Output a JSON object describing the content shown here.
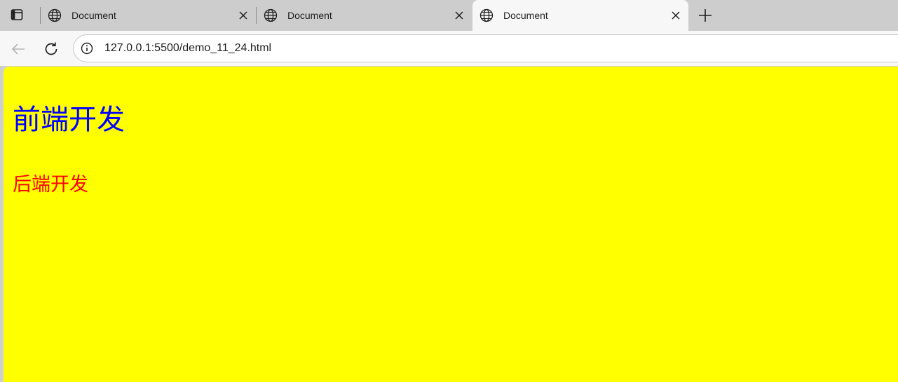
{
  "browser": {
    "tabs": [
      {
        "title": "Document",
        "active": false
      },
      {
        "title": "Document",
        "active": false
      },
      {
        "title": "Document",
        "active": true
      }
    ],
    "url": "127.0.0.1:5500/demo_11_24.html"
  },
  "page": {
    "background_color": "#ffff00",
    "heading_front": {
      "text": "前端开发",
      "color": "#0000ff"
    },
    "heading_back": {
      "text": "后端开发",
      "color": "#ff0000"
    }
  },
  "icons": {
    "tab_actions": "tab-actions-icon",
    "globe": "globe-icon",
    "close": "close-icon",
    "new_tab": "plus-icon",
    "back": "arrow-left-icon",
    "reload": "reload-icon",
    "site_info": "info-icon"
  }
}
